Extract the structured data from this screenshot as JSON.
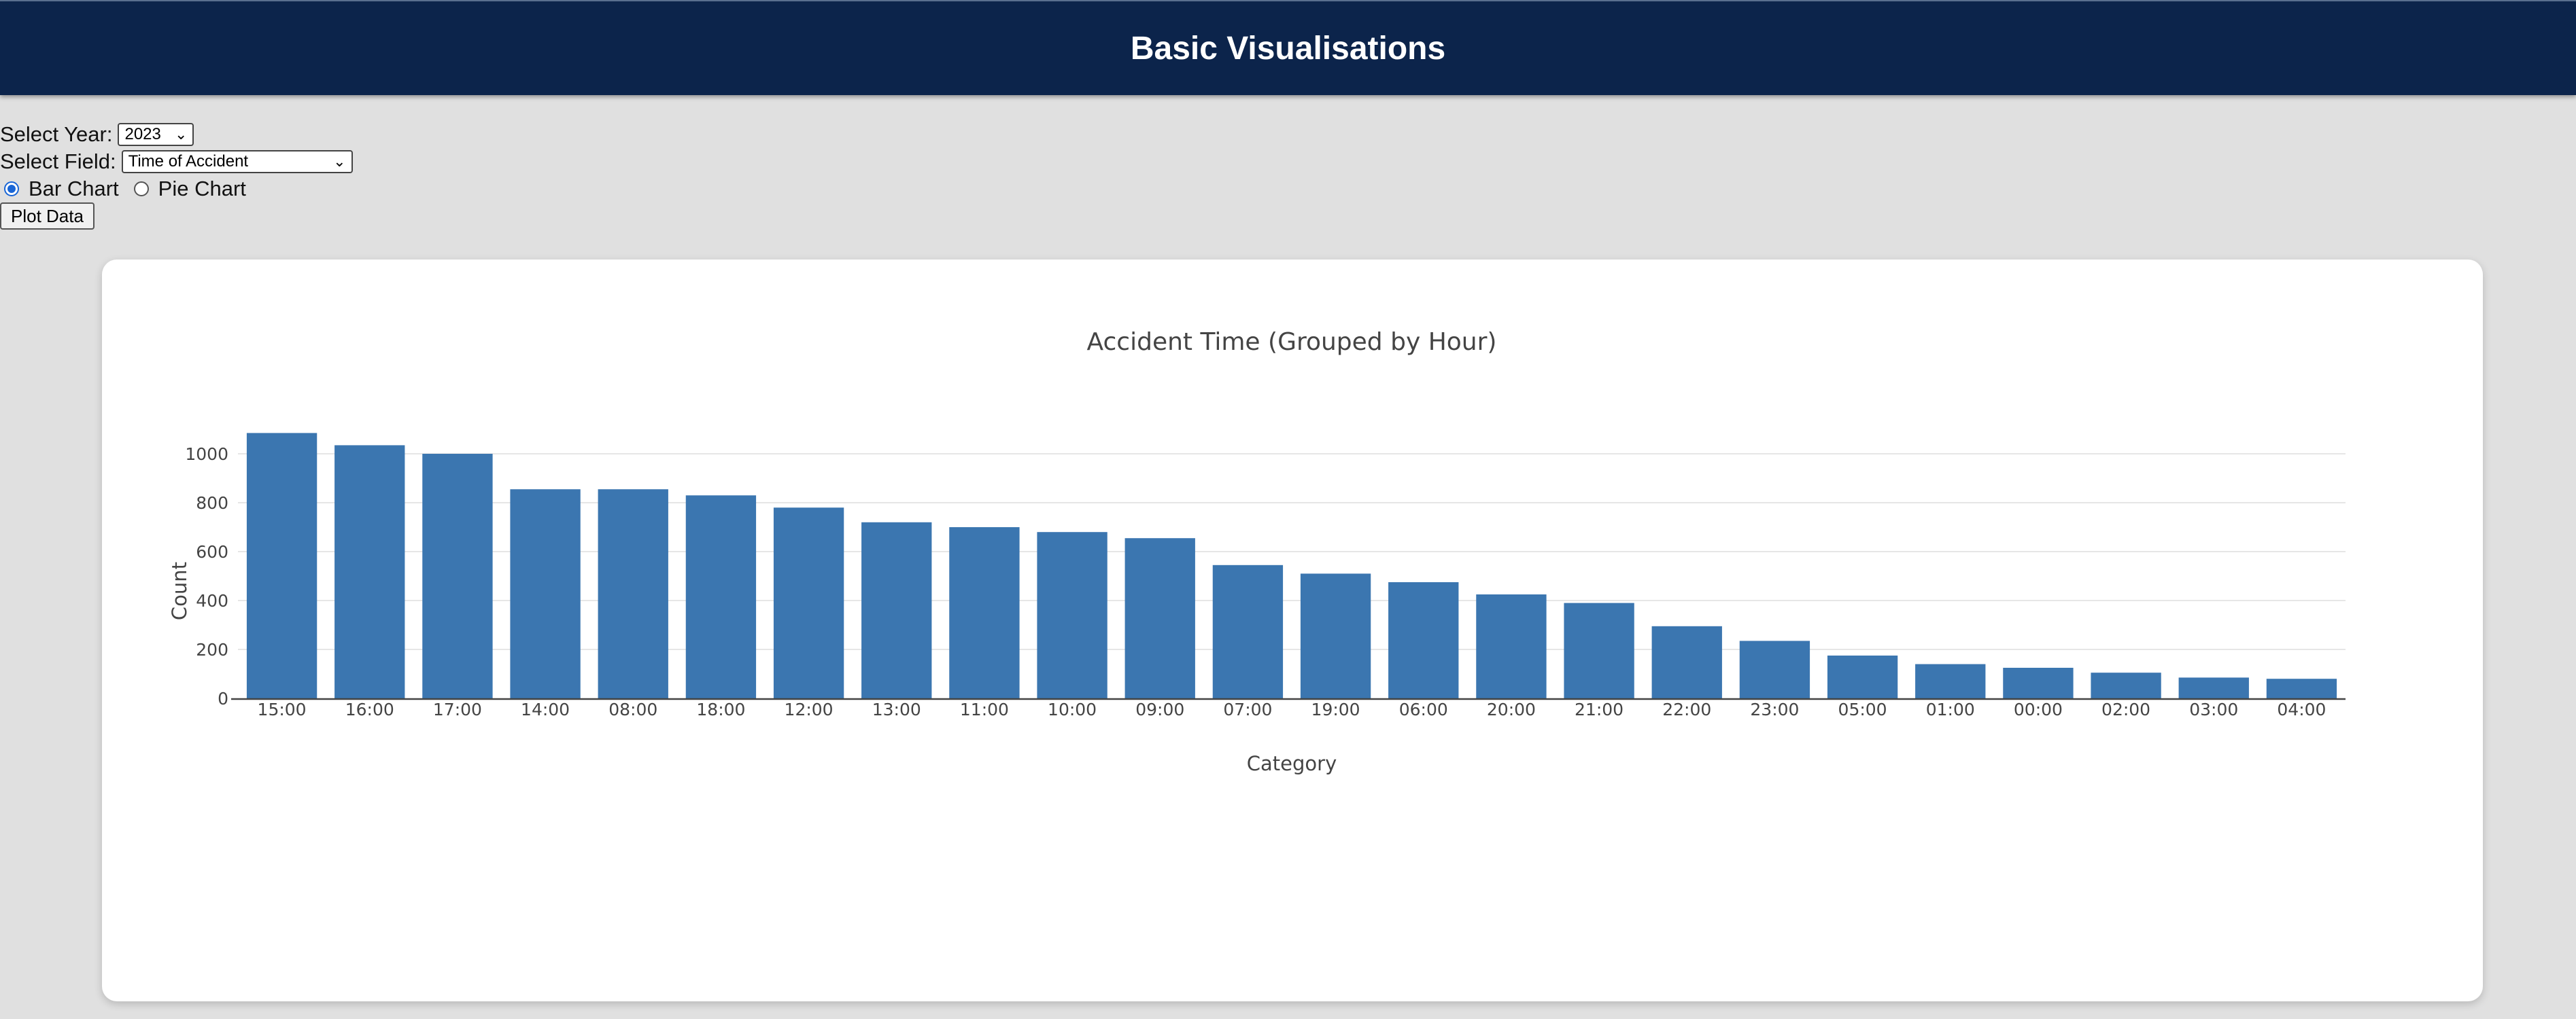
{
  "header": {
    "title": "Basic Visualisations"
  },
  "controls": {
    "year_label": "Select Year:",
    "year_value": "2023",
    "field_label": "Select Field:",
    "field_value": "Time of Accident",
    "bar_label": "Bar Chart",
    "pie_label": "Pie Chart",
    "selected_chart": "bar",
    "plot_label": "Plot Data"
  },
  "icons": {
    "dropdown": "chevron-down-icon"
  },
  "chart_data": {
    "type": "bar",
    "title": "Accident Time (Grouped by Hour)",
    "xlabel": "Category",
    "ylabel": "Count",
    "ylim": [
      0,
      1100
    ],
    "yticks": [
      0,
      200,
      400,
      600,
      800,
      1000
    ],
    "grid": true,
    "color": "#3b76b0",
    "categories": [
      "15:00",
      "16:00",
      "17:00",
      "14:00",
      "08:00",
      "18:00",
      "12:00",
      "13:00",
      "11:00",
      "10:00",
      "09:00",
      "07:00",
      "19:00",
      "06:00",
      "20:00",
      "21:00",
      "22:00",
      "23:00",
      "05:00",
      "01:00",
      "00:00",
      "02:00",
      "03:00",
      "04:00"
    ],
    "values": [
      1085,
      1035,
      1000,
      855,
      855,
      830,
      780,
      720,
      700,
      680,
      655,
      545,
      510,
      475,
      425,
      390,
      295,
      235,
      175,
      140,
      125,
      105,
      85,
      80
    ]
  }
}
